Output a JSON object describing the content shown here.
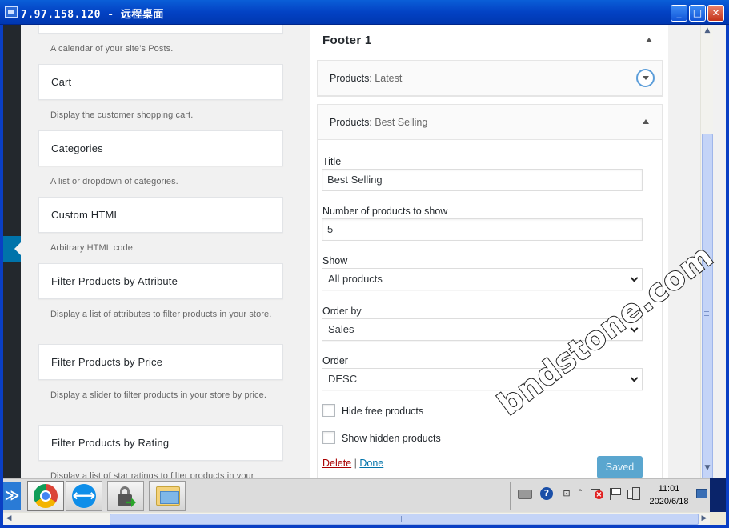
{
  "window": {
    "title": "7.97.158.120 - 远程桌面",
    "controls": {
      "minimize": "_",
      "maximize": "□",
      "close": "✕"
    }
  },
  "widgets": [
    {
      "desc": "A calendar of your site’s Posts."
    },
    {
      "name": "Cart",
      "desc": "Display the customer shopping cart."
    },
    {
      "name": "Categories",
      "desc": "A list or dropdown of categories."
    },
    {
      "name": "Custom HTML",
      "desc": "Arbitrary HTML code."
    },
    {
      "name": "Filter Products by Attribute",
      "desc": "Display a list of attributes to filter products in your store."
    },
    {
      "name": "Filter Products by Price",
      "desc": "Display a slider to filter products in your store by price."
    },
    {
      "name": "Filter Products by Rating",
      "desc": "Display a list of star ratings to filter products in your"
    }
  ],
  "sidebar": {
    "title": "Footer 1",
    "collapsed_widget": {
      "type": "Products:",
      "subtitle": "Latest"
    },
    "open_widget": {
      "type": "Products:",
      "subtitle": "Best Selling",
      "title_label": "Title",
      "title_value": "Best Selling",
      "number_label": "Number of products to show",
      "number_value": "5",
      "show_label": "Show",
      "show_value": "All products",
      "orderby_label": "Order by",
      "orderby_value": "Sales",
      "order_label": "Order",
      "order_value": "DESC",
      "hide_free_label": "Hide free products",
      "hide_free_checked": false,
      "show_hidden_label": "Show hidden products",
      "show_hidden_checked": false,
      "delete_label": "Delete",
      "separator": "|",
      "done_label": "Done",
      "saved_label": "Saved"
    }
  },
  "taskbar": {
    "apps": [
      "chrome-icon",
      "teamviewer-icon",
      "lock-transfer-icon",
      "folder-icon"
    ],
    "clock_time": "11:01",
    "clock_date": "2020/6/18"
  },
  "watermark": "bndstone.com",
  "colors": {
    "wp_blue": "#0073aa",
    "delete_red": "#a00",
    "saved_button": "#5aa6cf",
    "titlebar": "#0342c4"
  }
}
